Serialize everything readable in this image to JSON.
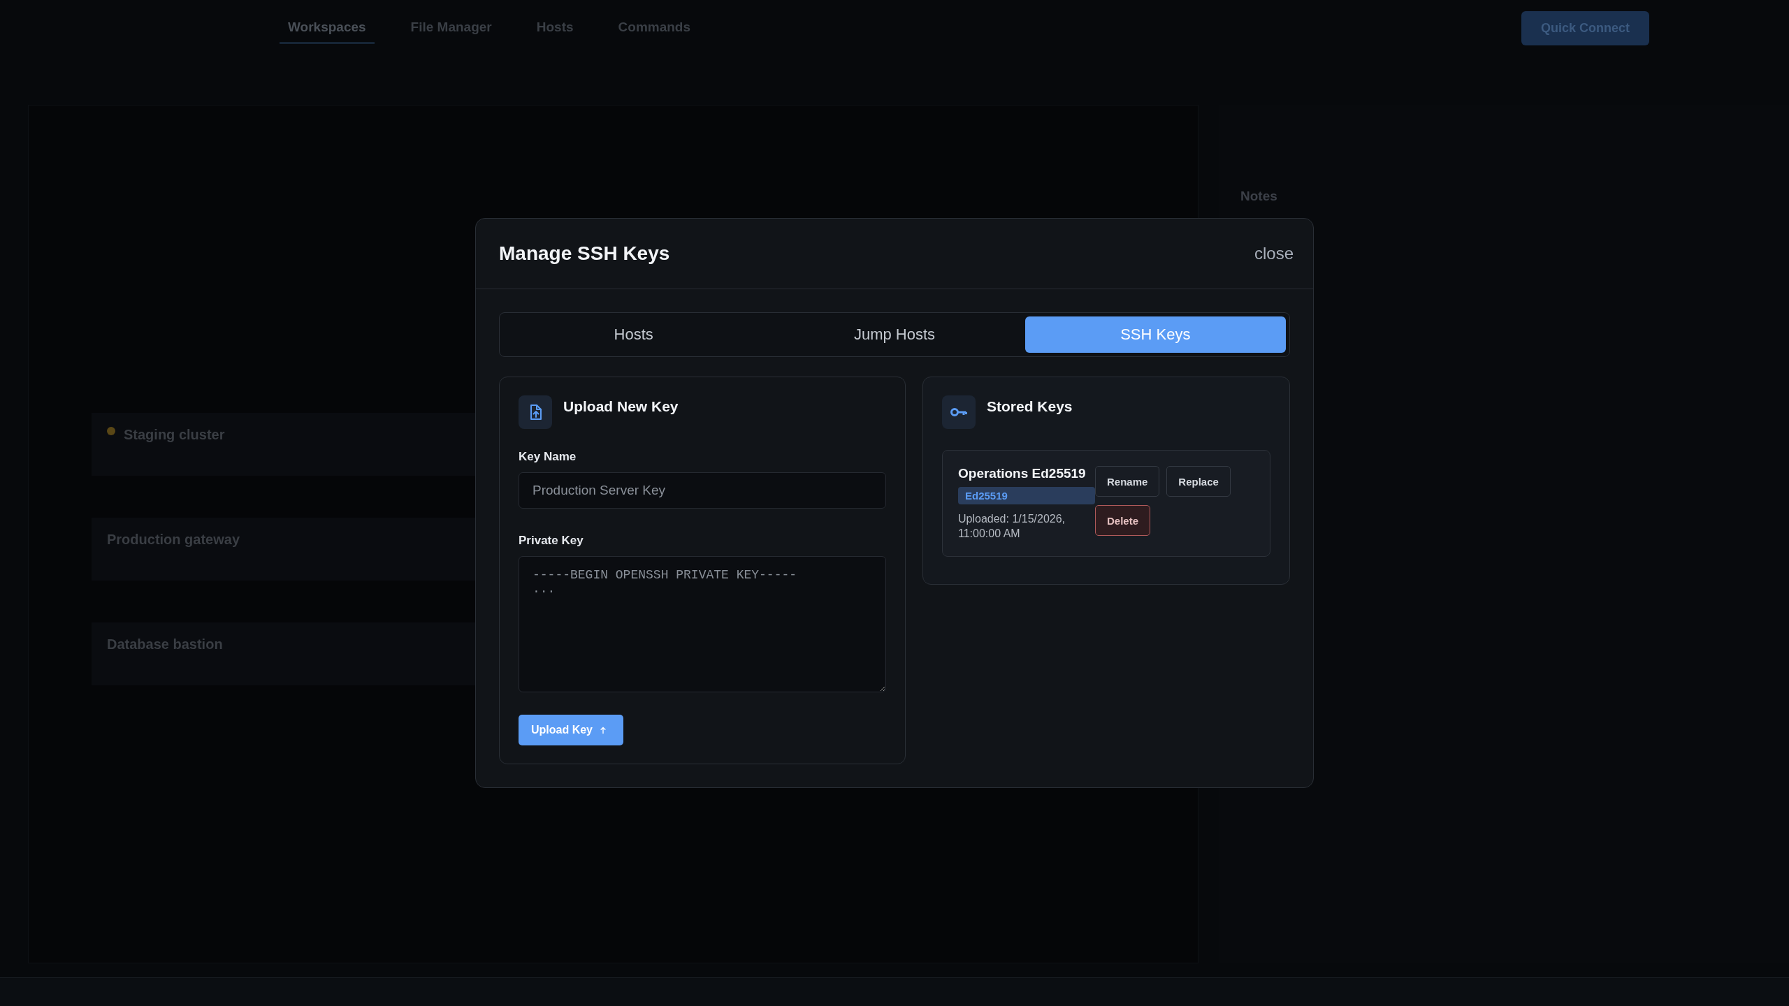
{
  "background": {
    "nav_tabs": [
      {
        "label": "Workspaces",
        "selected": true
      },
      {
        "label": "File Manager",
        "selected": false
      },
      {
        "label": "Hosts",
        "selected": false
      },
      {
        "label": "Commands",
        "selected": false
      }
    ],
    "quick_connect": "Quick Connect",
    "host_groups": [
      {
        "name": "Staging cluster",
        "favorite": true
      },
      {
        "name": "Production gateway",
        "favorite": false
      },
      {
        "name": "Database bastion",
        "favorite": false
      }
    ],
    "notes_title": "Notes"
  },
  "modal": {
    "title": "Manage SSH Keys",
    "close": "close",
    "tabs": [
      {
        "label": "Hosts",
        "selected": false
      },
      {
        "label": "Jump Hosts",
        "selected": false
      },
      {
        "label": "SSH Keys",
        "selected": true
      }
    ],
    "upload": {
      "title": "Upload New Key",
      "key_name_label": "Key Name",
      "key_name": {
        "placeholder": "Production Server Key"
      },
      "private_key_label": "Private Key",
      "private_key": {
        "placeholder": "-----BEGIN OPENSSH PRIVATE KEY-----\n..."
      },
      "button": "Upload Key"
    },
    "stored": {
      "title": "Stored Keys",
      "keys": [
        {
          "name": "Operations Ed25519",
          "type": "Ed25519",
          "uploaded": "Uploaded: 1/15/2026, 11:00:00 AM",
          "actions": [
            {
              "label": "Rename",
              "kind": "normal"
            },
            {
              "label": "Replace",
              "kind": "normal"
            },
            {
              "label": "Delete",
              "kind": "danger"
            }
          ]
        }
      ]
    }
  }
}
